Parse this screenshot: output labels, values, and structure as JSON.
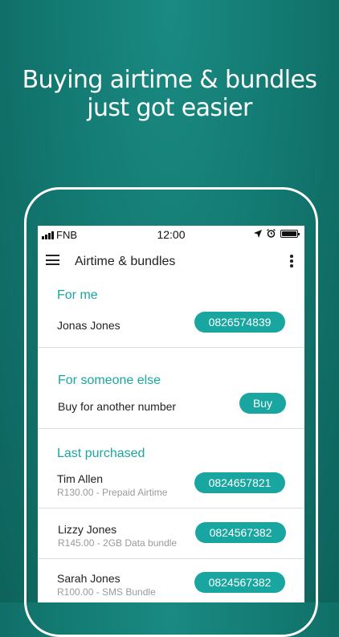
{
  "headline": {
    "line1": "Buying airtime & bundles",
    "line2": "just got easier"
  },
  "status_bar": {
    "carrier": "FNB",
    "time": "12:00"
  },
  "app_bar": {
    "title": "Airtime & bundles"
  },
  "for_me": {
    "title": "For me",
    "name": "Jonas Jones",
    "number": "0826574839"
  },
  "for_someone_else": {
    "title": "For someone else",
    "label": "Buy for another number",
    "button": "Buy"
  },
  "last_purchased": {
    "title": "Last purchased",
    "items": [
      {
        "name": "Tim Allen",
        "detail": "R130.00 - Prepaid Airtime",
        "number": "0824657821"
      },
      {
        "name": "Lizzy Jones",
        "detail": "R145.00 - 2GB Data bundle",
        "number": "0824567382"
      },
      {
        "name": "Sarah Jones",
        "detail": "R100.00 - SMS Bundle",
        "number": "0824567382"
      }
    ]
  },
  "colors": {
    "accent": "#1aa6a0",
    "background": "#137a72"
  }
}
